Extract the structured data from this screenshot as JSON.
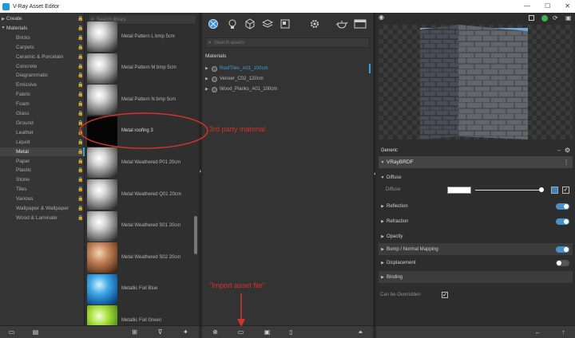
{
  "window": {
    "title": "V-Ray Asset Editor",
    "minimize": "—",
    "maximize": "☐",
    "close": "✕"
  },
  "categories": [
    {
      "label": "Create",
      "level": 0,
      "expanded": false,
      "locked": true
    },
    {
      "label": "Materials",
      "level": 0,
      "expanded": true,
      "locked": true
    },
    {
      "label": "Bricks",
      "level": 1,
      "locked": true
    },
    {
      "label": "Carpets",
      "level": 1,
      "locked": true
    },
    {
      "label": "Ceramic & Porcelain",
      "level": 1,
      "locked": true
    },
    {
      "label": "Concrete",
      "level": 1,
      "locked": true
    },
    {
      "label": "Diagrammatic",
      "level": 1,
      "locked": true
    },
    {
      "label": "Emissive",
      "level": 1,
      "locked": true
    },
    {
      "label": "Fabric",
      "level": 1,
      "locked": true
    },
    {
      "label": "Foam",
      "level": 1,
      "locked": true
    },
    {
      "label": "Glass",
      "level": 1,
      "locked": true
    },
    {
      "label": "Ground",
      "level": 1,
      "locked": true
    },
    {
      "label": "Leather",
      "level": 1,
      "locked": true
    },
    {
      "label": "Liquid",
      "level": 1,
      "locked": true
    },
    {
      "label": "Metal",
      "level": 1,
      "locked": true,
      "selected": true
    },
    {
      "label": "Paper",
      "level": 1,
      "locked": true
    },
    {
      "label": "Plastic",
      "level": 1,
      "locked": true
    },
    {
      "label": "Stone",
      "level": 1,
      "locked": true
    },
    {
      "label": "Tiles",
      "level": 1,
      "locked": true
    },
    {
      "label": "Various",
      "level": 1,
      "locked": true
    },
    {
      "label": "Wallpaper & Wallpaper",
      "level": 1,
      "locked": true
    },
    {
      "label": "Wood & Laminate",
      "level": 1,
      "locked": true
    }
  ],
  "library": {
    "search_placeholder": "Search library",
    "items": [
      {
        "name": "Metal Pattern L bmp 5cm",
        "thumb": "chrome"
      },
      {
        "name": "Metal Pattern M bmp 5cm",
        "thumb": "chrome"
      },
      {
        "name": "Metal Pattern N bmp 5cm",
        "thumb": "chrome"
      },
      {
        "name": "Metal roofing 3",
        "thumb": "black"
      },
      {
        "name": "Metal Weathered P01 20cm",
        "thumb": "chrome"
      },
      {
        "name": "Metal Weathered Q01 20cm",
        "thumb": "chrome"
      },
      {
        "name": "Metal Weathered S01 20cm",
        "thumb": "chrome"
      },
      {
        "name": "Metal Weathered S02 20cm",
        "thumb": "copper"
      },
      {
        "name": "Metallic Foil Blue",
        "thumb": "blue"
      },
      {
        "name": "Metallic Foil Green",
        "thumb": "green"
      }
    ]
  },
  "materials": {
    "search_placeholder": "Search assets",
    "heading": "Materials",
    "items": [
      {
        "name": "RoofTiles_A01_100cm",
        "selected": true
      },
      {
        "name": "Veneer_C02_120cm",
        "selected": false
      },
      {
        "name": "Wood_Planks_A01_100cm",
        "selected": false
      }
    ]
  },
  "properties": {
    "tab": "Generic",
    "root": "VRayBRDF",
    "rows": [
      {
        "label": "Diffuse",
        "expanded": true,
        "toggle": null
      },
      {
        "label": "Reflection",
        "expanded": false,
        "toggle": "on"
      },
      {
        "label": "Refraction",
        "expanded": false,
        "toggle": "on"
      },
      {
        "label": "Opacity",
        "expanded": false,
        "toggle": null
      },
      {
        "label": "Bump / Normal Mapping",
        "expanded": false,
        "toggle": "on"
      },
      {
        "label": "Displacement",
        "expanded": false,
        "toggle": "off"
      },
      {
        "label": "Binding",
        "expanded": false,
        "toggle": null
      }
    ],
    "diffuse_label": "Diffuse",
    "diffuse_color": "#ffffff",
    "can_be_overridden": "Can be Overridden",
    "can_be_overridden_checked": true
  },
  "annotations": {
    "third_party": "3rd party material",
    "import_asset": "\"Import asset file\""
  },
  "colors": {
    "accent": "#39a0e0",
    "annotation": "#d4322c",
    "toggle_on": "#4a8fc8"
  }
}
